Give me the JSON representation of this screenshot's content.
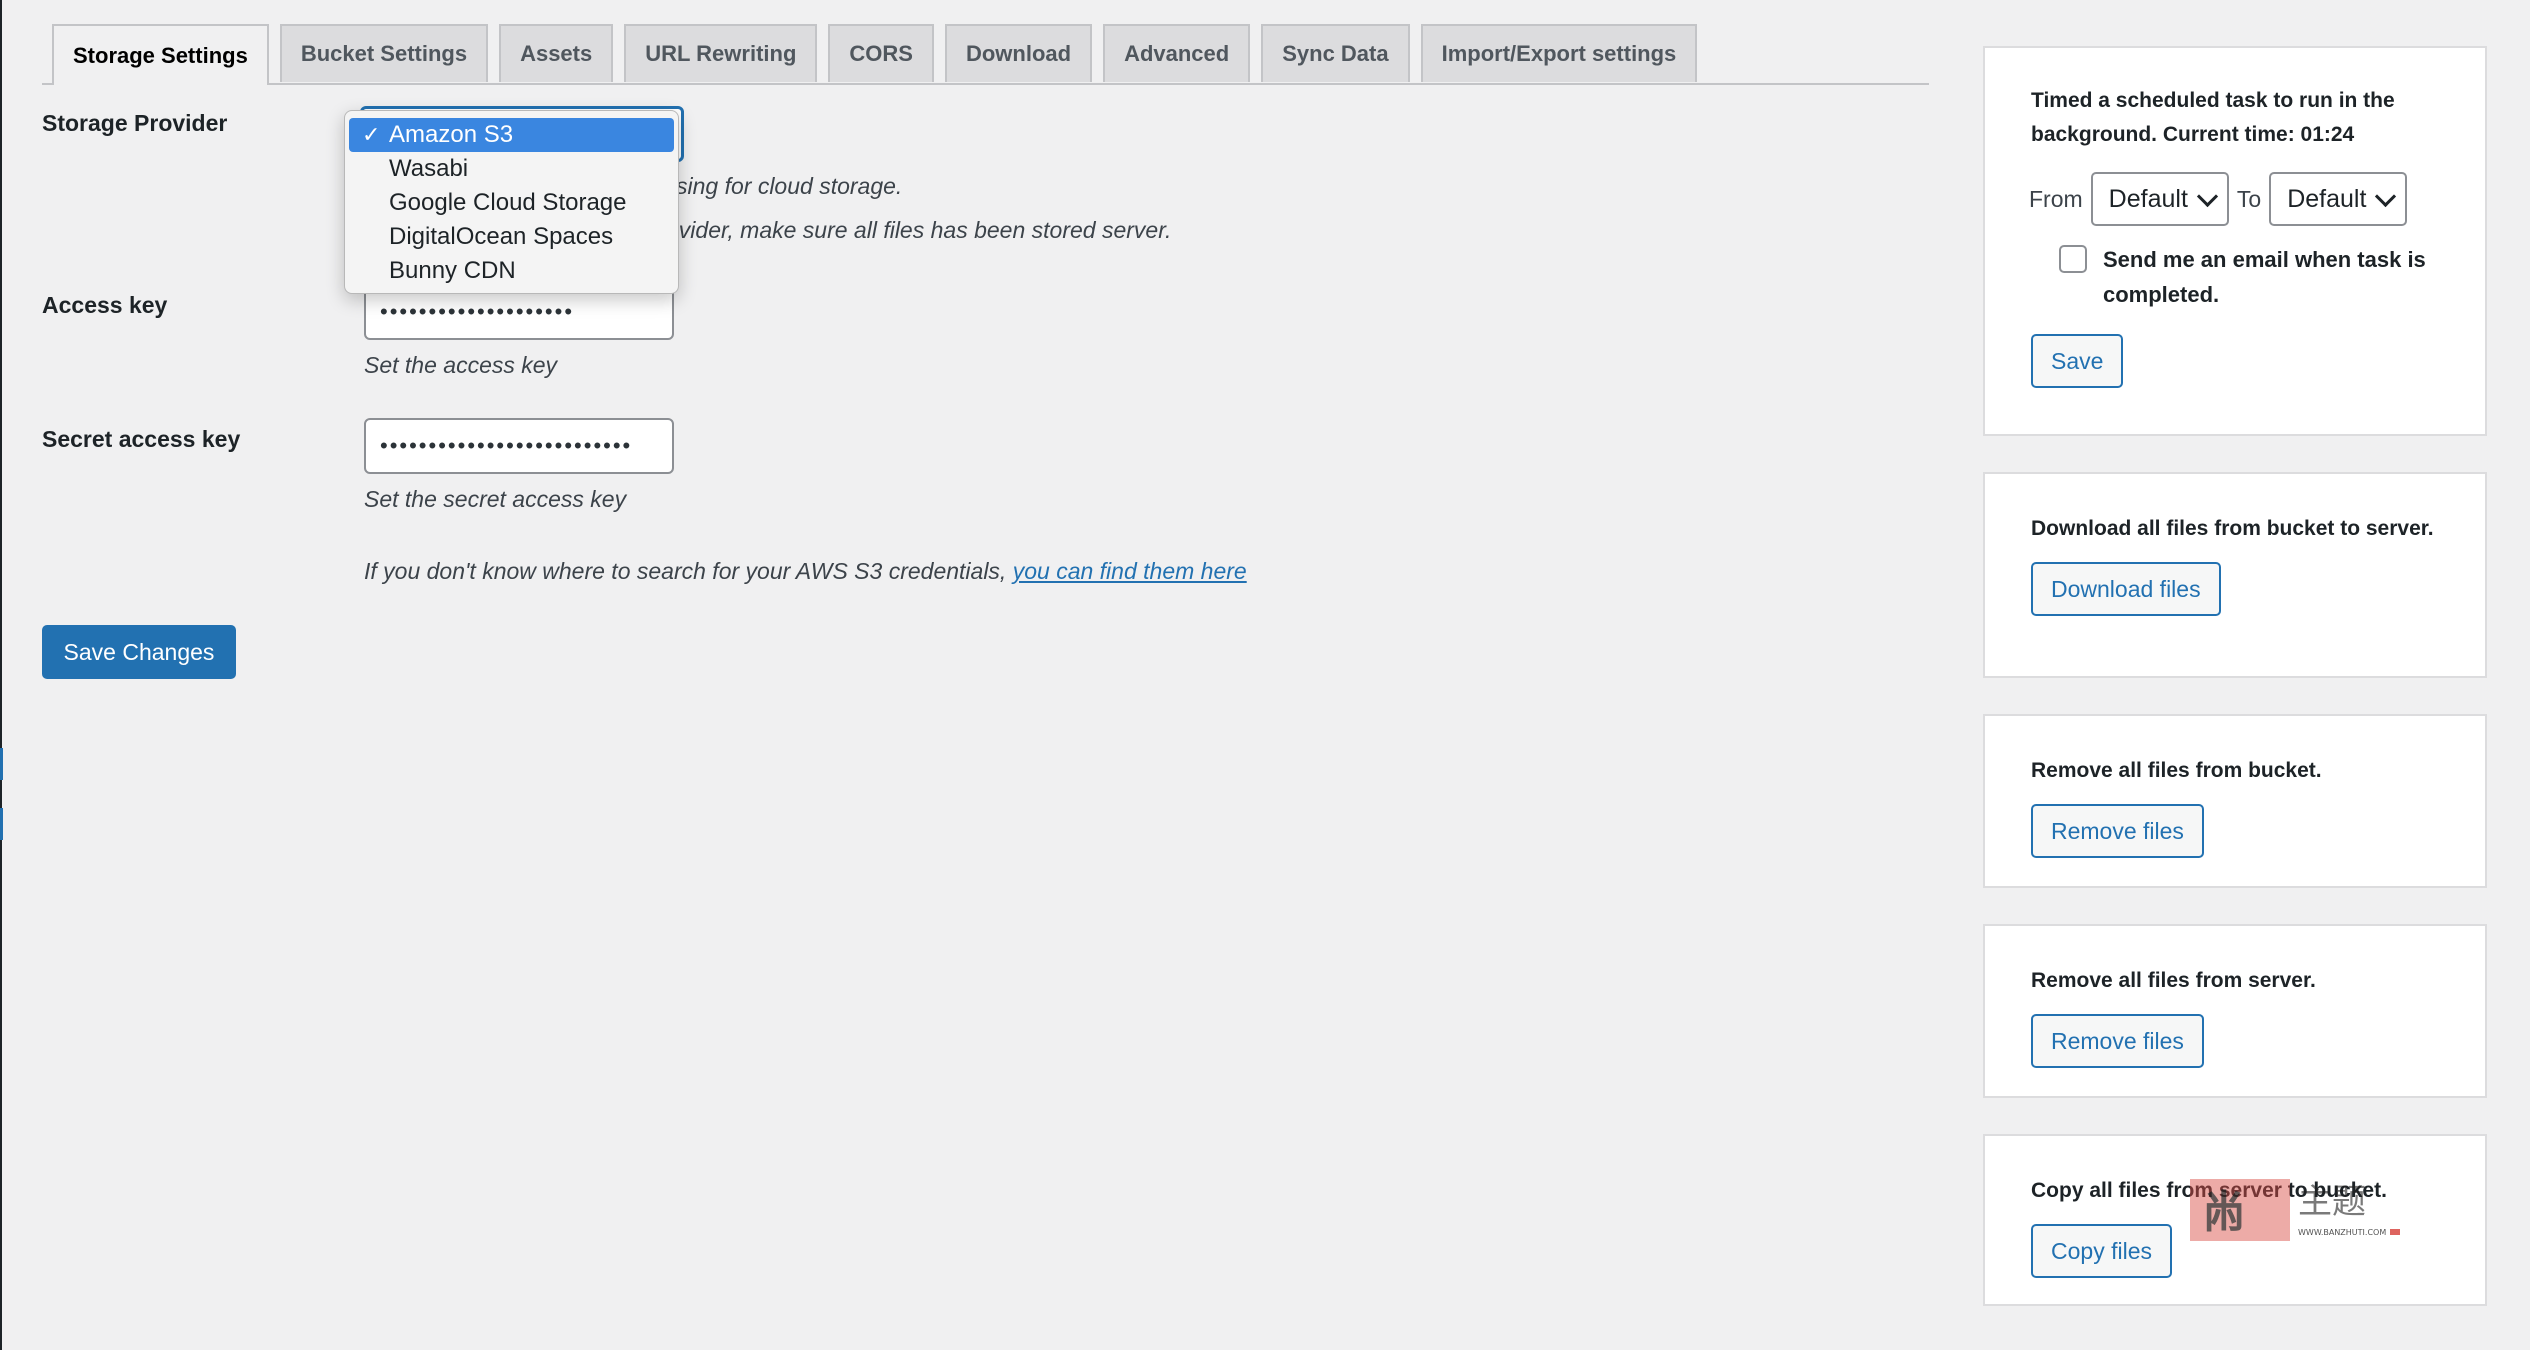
{
  "tabs": [
    {
      "label": "Storage Settings",
      "active": true
    },
    {
      "label": "Bucket Settings",
      "active": false
    },
    {
      "label": "Assets",
      "active": false
    },
    {
      "label": "URL Rewriting",
      "active": false
    },
    {
      "label": "CORS",
      "active": false
    },
    {
      "label": "Download",
      "active": false
    },
    {
      "label": "Advanced",
      "active": false
    },
    {
      "label": "Sync Data",
      "active": false
    },
    {
      "label": "Import/Export settings",
      "active": false
    }
  ],
  "form": {
    "storage_provider": {
      "label": "Storage Provider",
      "selected": "Amazon S3",
      "options": [
        "Amazon S3",
        "Wasabi",
        "Google Cloud Storage",
        "DigitalOcean Spaces",
        "Bunny CDN"
      ],
      "desc_1_visible": "sing for cloud storage.",
      "desc_2_visible": "ovider, make sure all files has been stored server."
    },
    "access_key": {
      "label": "Access key",
      "value": "••••••••••••••••••••",
      "desc": "Set the access key"
    },
    "secret_access_key": {
      "label": "Secret access key",
      "value": "••••••••••••••••••••••••••",
      "desc": "Set the secret access key"
    },
    "credentials_help": {
      "text": "If you don't know where to search for your AWS S3 credentials, ",
      "link_text": "you can find them here"
    },
    "save_label": "Save Changes"
  },
  "sidebar": {
    "schedule": {
      "text": "Timed a scheduled task to run in the background. Current time: 01:24",
      "from_label": "From",
      "from_value": "Default",
      "to_label": "To",
      "to_value": "Default",
      "email_label": "Send me an email when task is completed.",
      "save_label": "Save"
    },
    "download": {
      "text": "Download all files from bucket to server.",
      "button": "Download files"
    },
    "remove_bucket": {
      "text": "Remove all files from bucket.",
      "button": "Remove files"
    },
    "remove_server": {
      "text": "Remove all files from server.",
      "button": "Remove files"
    },
    "copy": {
      "text": "Copy all files from server to bucket.",
      "button": "Copy files"
    }
  },
  "watermark": {
    "text": "WWW.BANZHUTI.COM"
  },
  "colors": {
    "accent": "#2271b1",
    "selected_option": "#3a86e0",
    "background": "#f0f0f1"
  }
}
